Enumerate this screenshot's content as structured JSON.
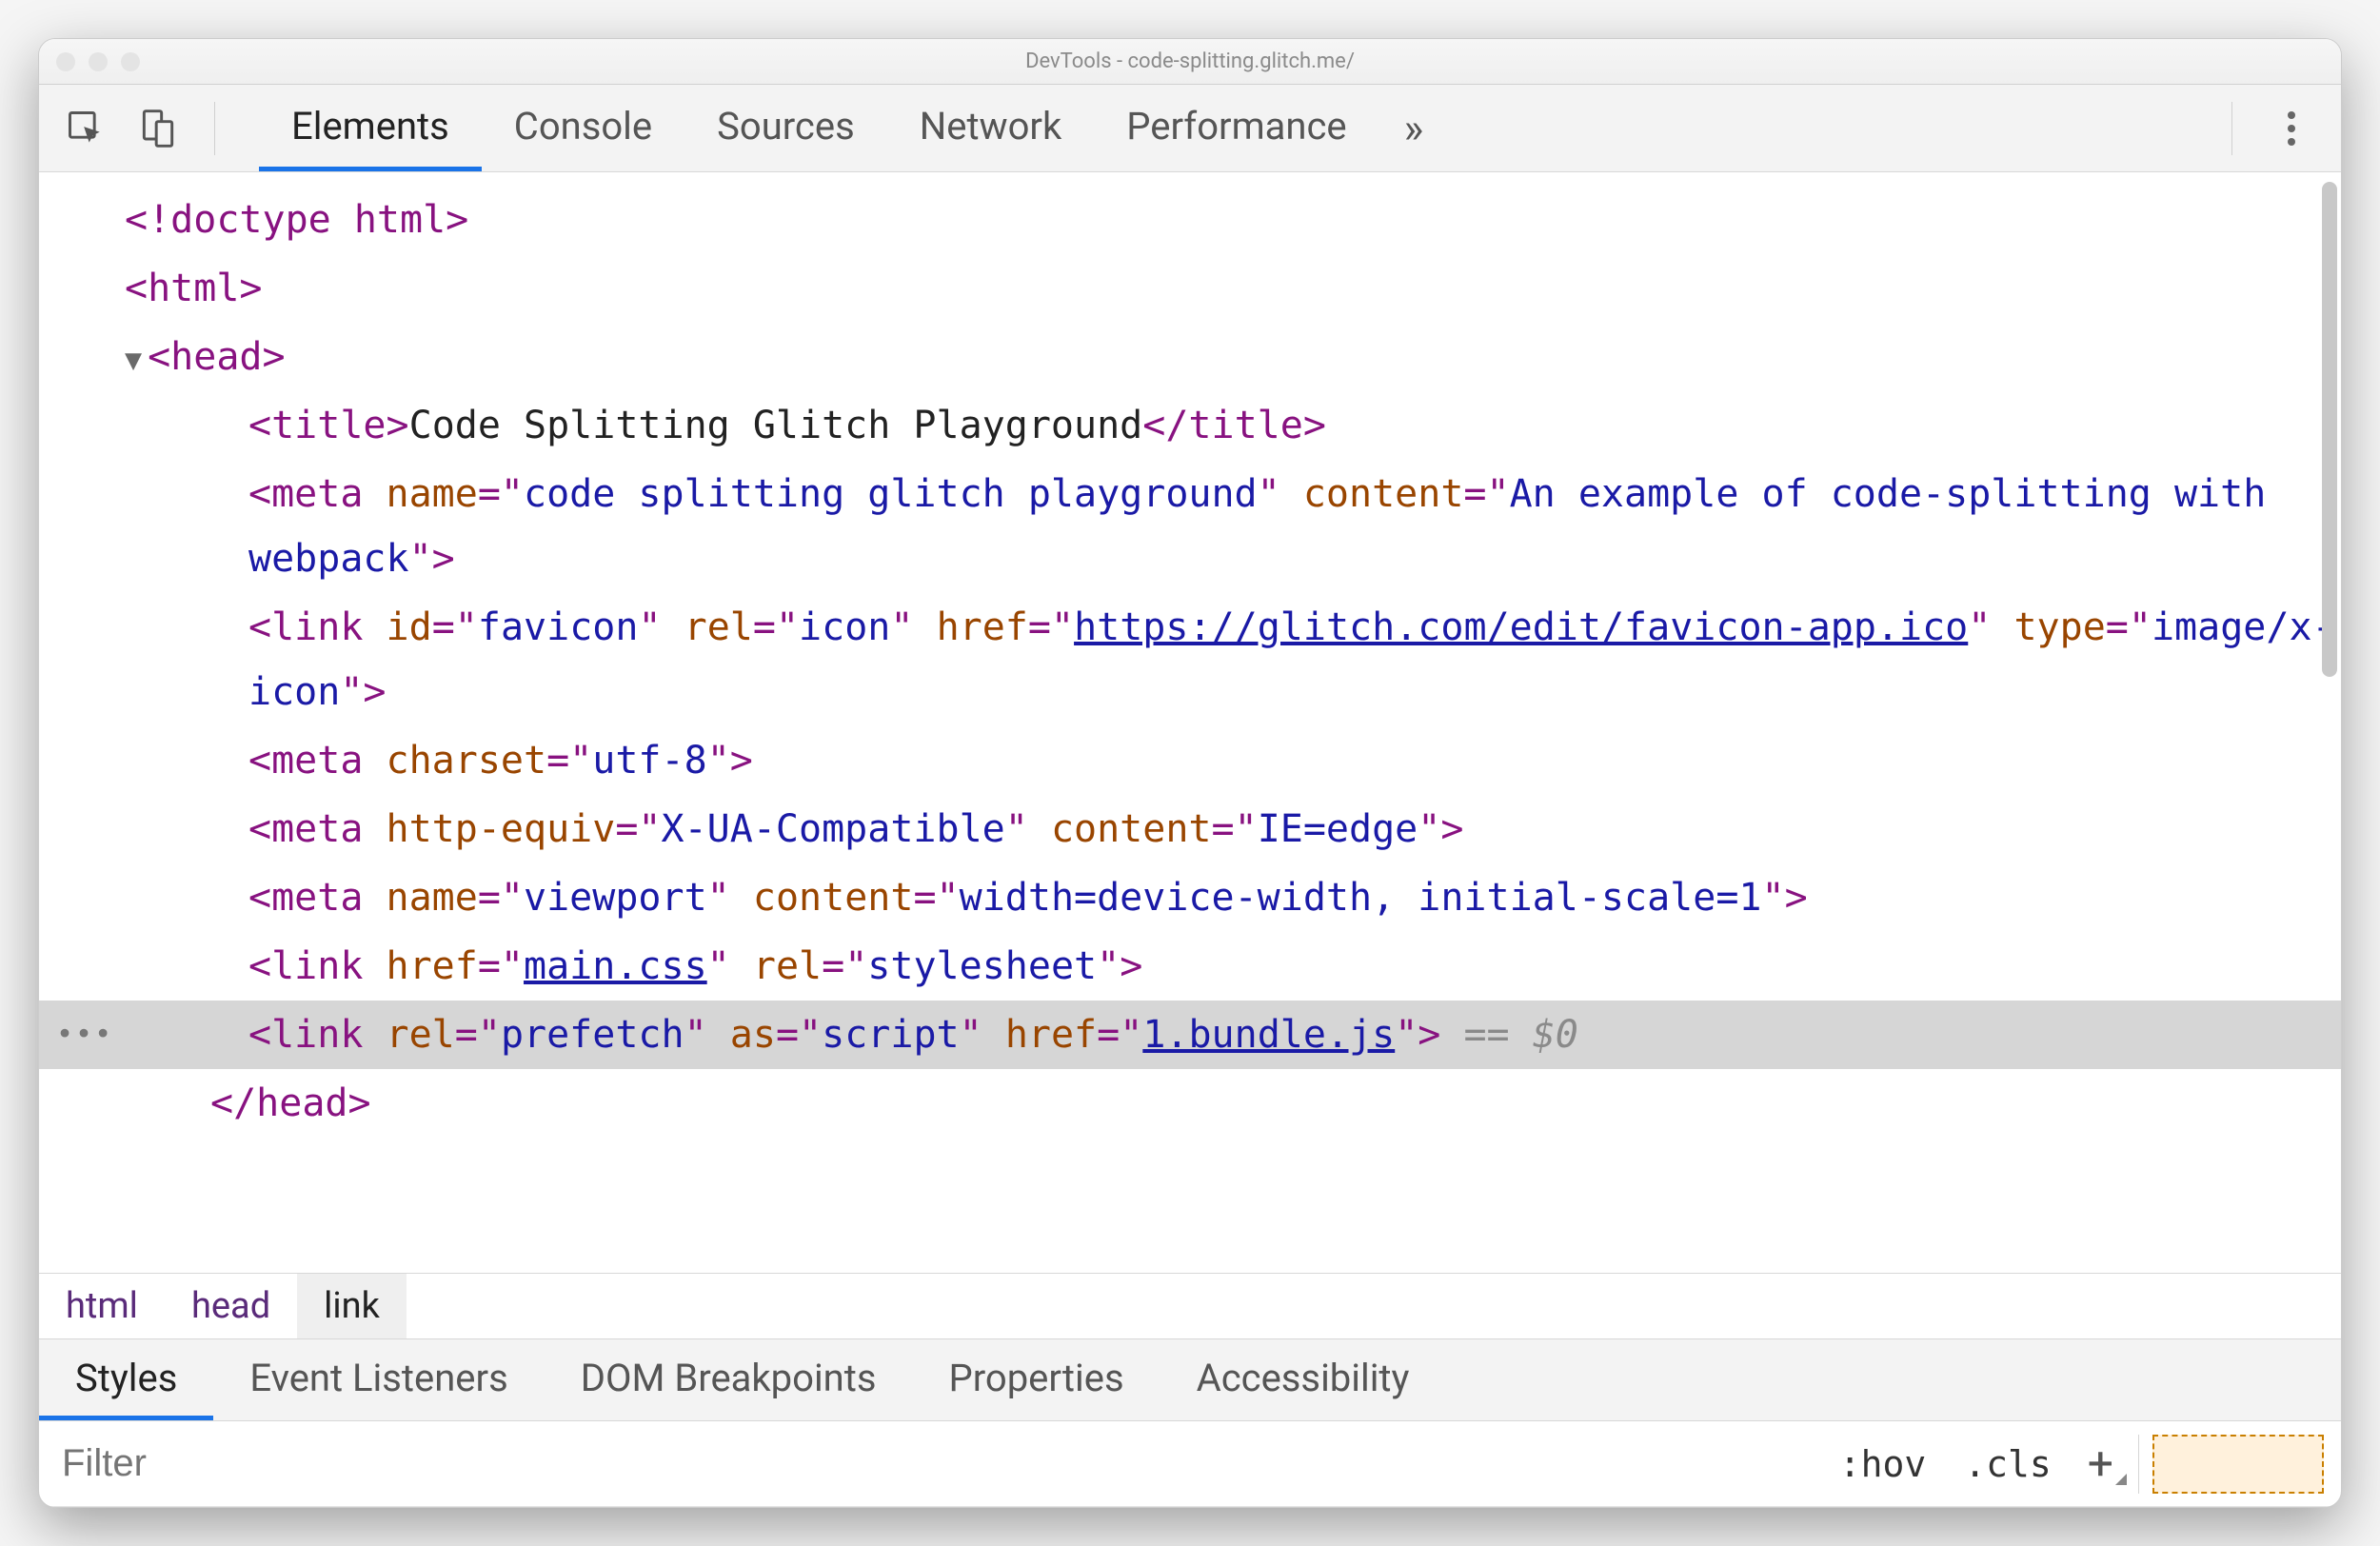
{
  "window": {
    "title": "DevTools - code-splitting.glitch.me/"
  },
  "tabs": {
    "items": [
      "Elements",
      "Console",
      "Sources",
      "Network",
      "Performance"
    ],
    "active": 0,
    "overflow_glyph": "»"
  },
  "dom": {
    "doctype": "<!doctype html>",
    "html_open": "html",
    "head_open": "head",
    "title_tag": "title",
    "title_text": "Code Splitting Glitch Playground",
    "meta1": {
      "tag": "meta",
      "a1": "name",
      "v1": "code splitting glitch playground",
      "a2": "content",
      "v2": "An example of code-splitting with webpack"
    },
    "link1": {
      "tag": "link",
      "a1": "id",
      "v1": "favicon",
      "a2": "rel",
      "v2": "icon",
      "a3": "href",
      "v3": "https://glitch.com/edit/favicon-app.ico",
      "a4": "type",
      "v4": "image/x-icon"
    },
    "meta2": {
      "tag": "meta",
      "a1": "charset",
      "v1": "utf-8"
    },
    "meta3": {
      "tag": "meta",
      "a1": "http-equiv",
      "v1": "X-UA-Compatible",
      "a2": "content",
      "v2": "IE=edge"
    },
    "meta4": {
      "tag": "meta",
      "a1": "name",
      "v1": "viewport",
      "a2": "content",
      "v2": "width=device-width, initial-scale=1"
    },
    "link2": {
      "tag": "link",
      "a1": "href",
      "v1": "main.css",
      "a2": "rel",
      "v2": "stylesheet"
    },
    "link3": {
      "tag": "link",
      "a1": "rel",
      "v1": "prefetch",
      "a2": "as",
      "v2": "script",
      "a3": "href",
      "v3": "1.bundle.js"
    },
    "head_close": "head",
    "selected_suffix": " == $0"
  },
  "breadcrumb": [
    "html",
    "head",
    "link"
  ],
  "subtabs": {
    "items": [
      "Styles",
      "Event Listeners",
      "DOM Breakpoints",
      "Properties",
      "Accessibility"
    ],
    "active": 0
  },
  "filterbar": {
    "placeholder": "Filter",
    "hov": ":hov",
    "cls": ".cls",
    "plus": "+"
  }
}
